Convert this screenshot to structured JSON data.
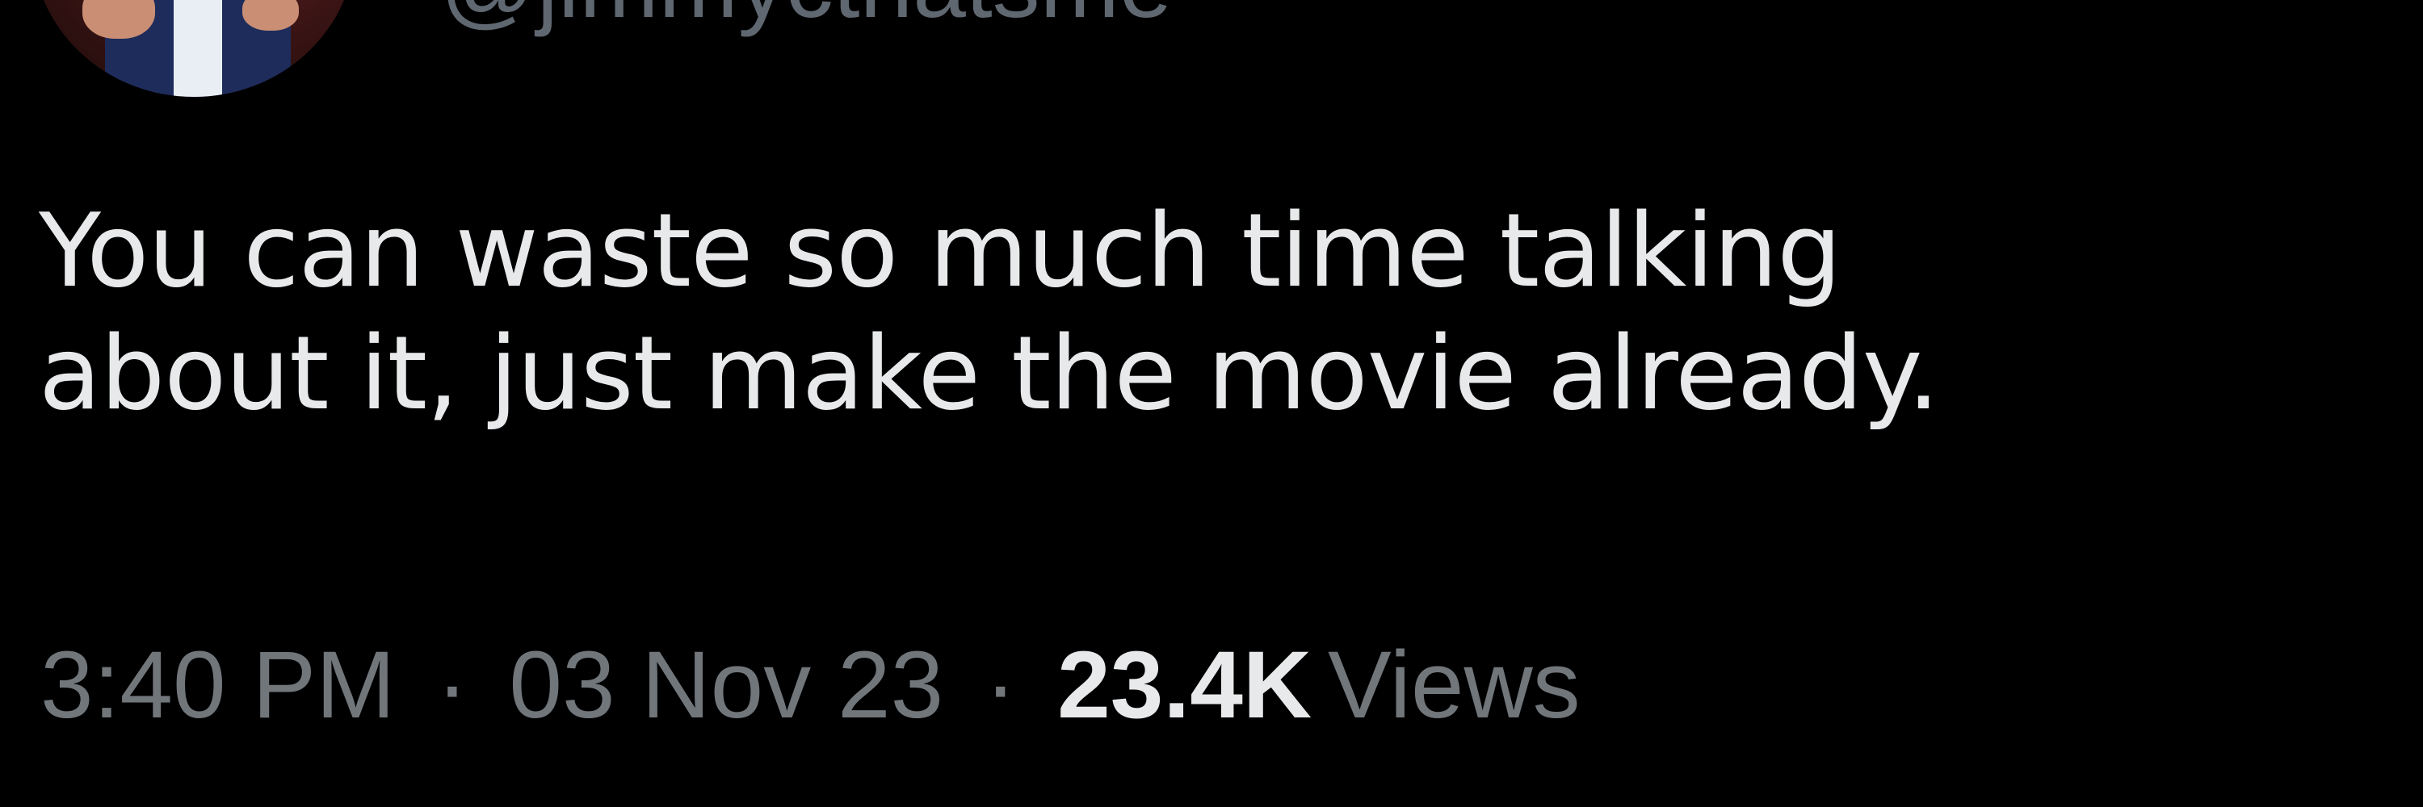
{
  "author": {
    "handle": "@jimmycthatsme"
  },
  "tweet": {
    "text_line_1": "You can waste so much time talking",
    "text_line_2": "about it, just make the movie already."
  },
  "meta": {
    "time": "3:40 PM",
    "separator": "·",
    "date": "03 Nov 23",
    "views_count": "23.4K",
    "views_label": "Views"
  },
  "colors": {
    "background": "#000000",
    "text_primary": "#e7e9ea",
    "text_secondary": "#71767b"
  },
  "icons": {
    "avatar": "profile-photo"
  }
}
